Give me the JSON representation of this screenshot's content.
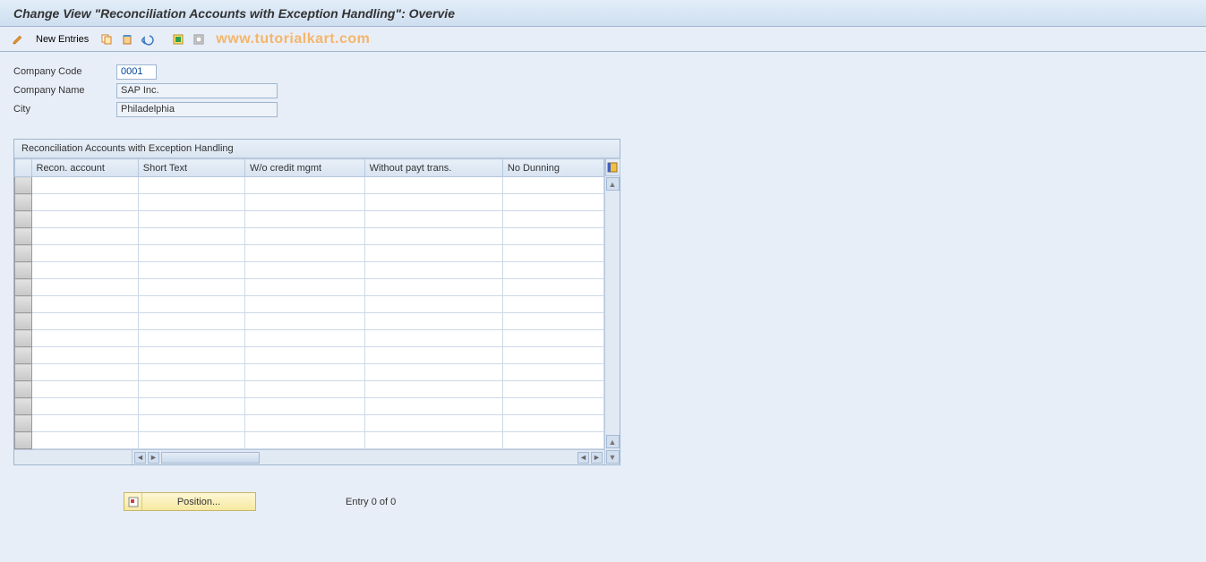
{
  "title": "Change View \"Reconciliation Accounts with Exception Handling\": Overvie",
  "toolbar": {
    "new_entries": "New Entries"
  },
  "watermark": "www.tutorialkart.com",
  "form": {
    "company_code_label": "Company Code",
    "company_code_value": "0001",
    "company_name_label": "Company Name",
    "company_name_value": "SAP Inc.",
    "city_label": "City",
    "city_value": "Philadelphia"
  },
  "grid": {
    "title": "Reconciliation Accounts with Exception Handling",
    "columns": [
      "Recon. account",
      "Short Text",
      "W/o credit mgmt",
      "Without payt trans.",
      "No Dunning"
    ],
    "row_count": 16
  },
  "footer": {
    "position_label": "Position...",
    "entry_text": "Entry 0 of 0"
  }
}
